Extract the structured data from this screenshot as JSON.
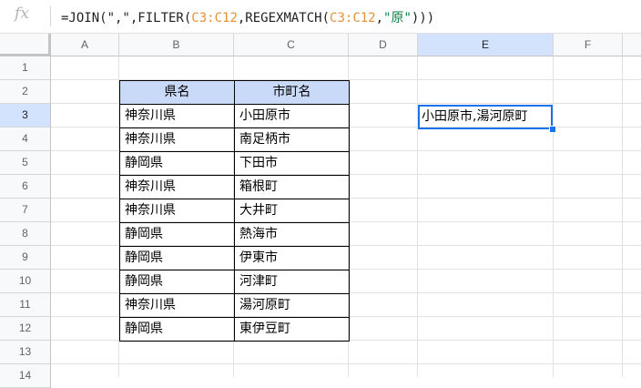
{
  "formula_bar": {
    "fx_label": "fx",
    "formula_parts": [
      "=JOIN(\",\",FILTER(",
      "C3:C12",
      ",REGEXMATCH(",
      "C3:C12",
      ",",
      "\"原\"",
      ")))"
    ]
  },
  "columns": [
    "A",
    "B",
    "C",
    "D",
    "E",
    "F"
  ],
  "rows": [
    "1",
    "2",
    "3",
    "4",
    "5",
    "6",
    "7",
    "8",
    "9",
    "10",
    "11",
    "12",
    "13",
    "14"
  ],
  "table": {
    "headers": [
      "県名",
      "市町名"
    ],
    "rows": [
      [
        "神奈川県",
        "小田原市"
      ],
      [
        "神奈川県",
        "南足柄市"
      ],
      [
        "静岡県",
        "下田市"
      ],
      [
        "神奈川県",
        "箱根町"
      ],
      [
        "神奈川県",
        "大井町"
      ],
      [
        "静岡県",
        "熱海市"
      ],
      [
        "静岡県",
        "伊東市"
      ],
      [
        "静岡県",
        "河津町"
      ],
      [
        "神奈川県",
        "湯河原町"
      ],
      [
        "静岡県",
        "東伊豆町"
      ]
    ]
  },
  "selected_cell": {
    "ref": "E3",
    "value": "小田原市,湯河原町"
  },
  "colors": {
    "header_fill": "#c9daf8",
    "selection": "#1a73e8",
    "range_ref": "#e69138",
    "string_literal": "#0b8043"
  }
}
